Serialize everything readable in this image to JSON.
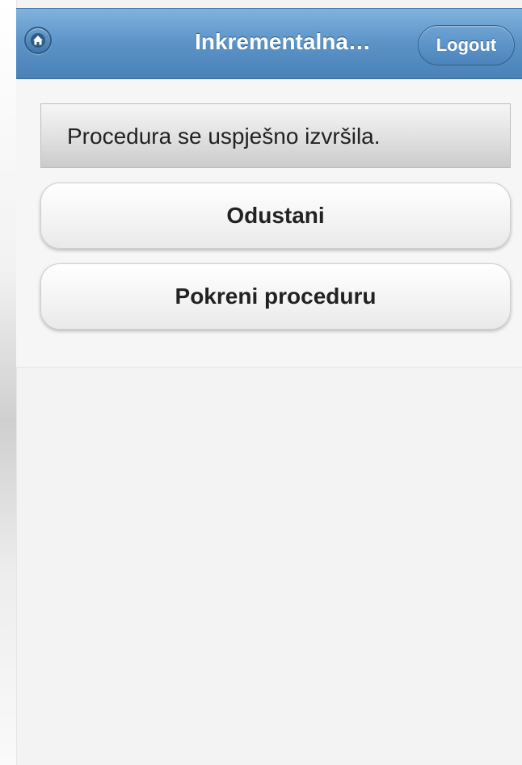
{
  "header": {
    "title": "Inkrementalna…",
    "home_icon": "home-icon",
    "logout_label": "Logout"
  },
  "main": {
    "message": "Procedura se uspješno izvršila.",
    "buttons": {
      "cancel_label": "Odustani",
      "run_label": "Pokreni proceduru"
    }
  },
  "colors": {
    "header_blue": "#5b93c7",
    "page_background": "#f3f3f3"
  }
}
